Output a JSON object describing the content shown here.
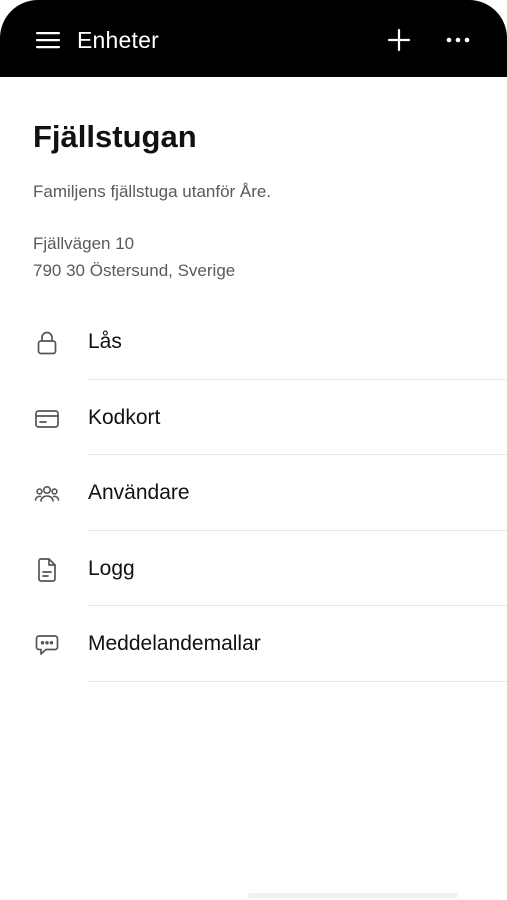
{
  "appbar": {
    "title": "Enheter",
    "icons": {
      "menu": "hamburger-menu-icon",
      "add": "plus-icon",
      "more": "more-horizontal-icon"
    }
  },
  "device": {
    "name": "Fjällstugan",
    "description": "Familjens fjällstuga utanför Åre.",
    "address_line1": "Fjällvägen 10",
    "address_line2": "790 30 Östersund, Sverige"
  },
  "menu": {
    "items": [
      {
        "label": "Lås",
        "icon": "lock-icon"
      },
      {
        "label": "Kodkort",
        "icon": "card-icon"
      },
      {
        "label": "Användare",
        "icon": "users-icon"
      },
      {
        "label": "Logg",
        "icon": "document-icon"
      },
      {
        "label": "Meddelandemallar",
        "icon": "message-icon"
      }
    ]
  },
  "colors": {
    "appbar_background": "#000000",
    "appbar_text": "#ffffff",
    "text_primary": "#111111",
    "text_secondary": "#5a5a5a",
    "divider": "#e6e6e6",
    "icon": "#555555"
  }
}
